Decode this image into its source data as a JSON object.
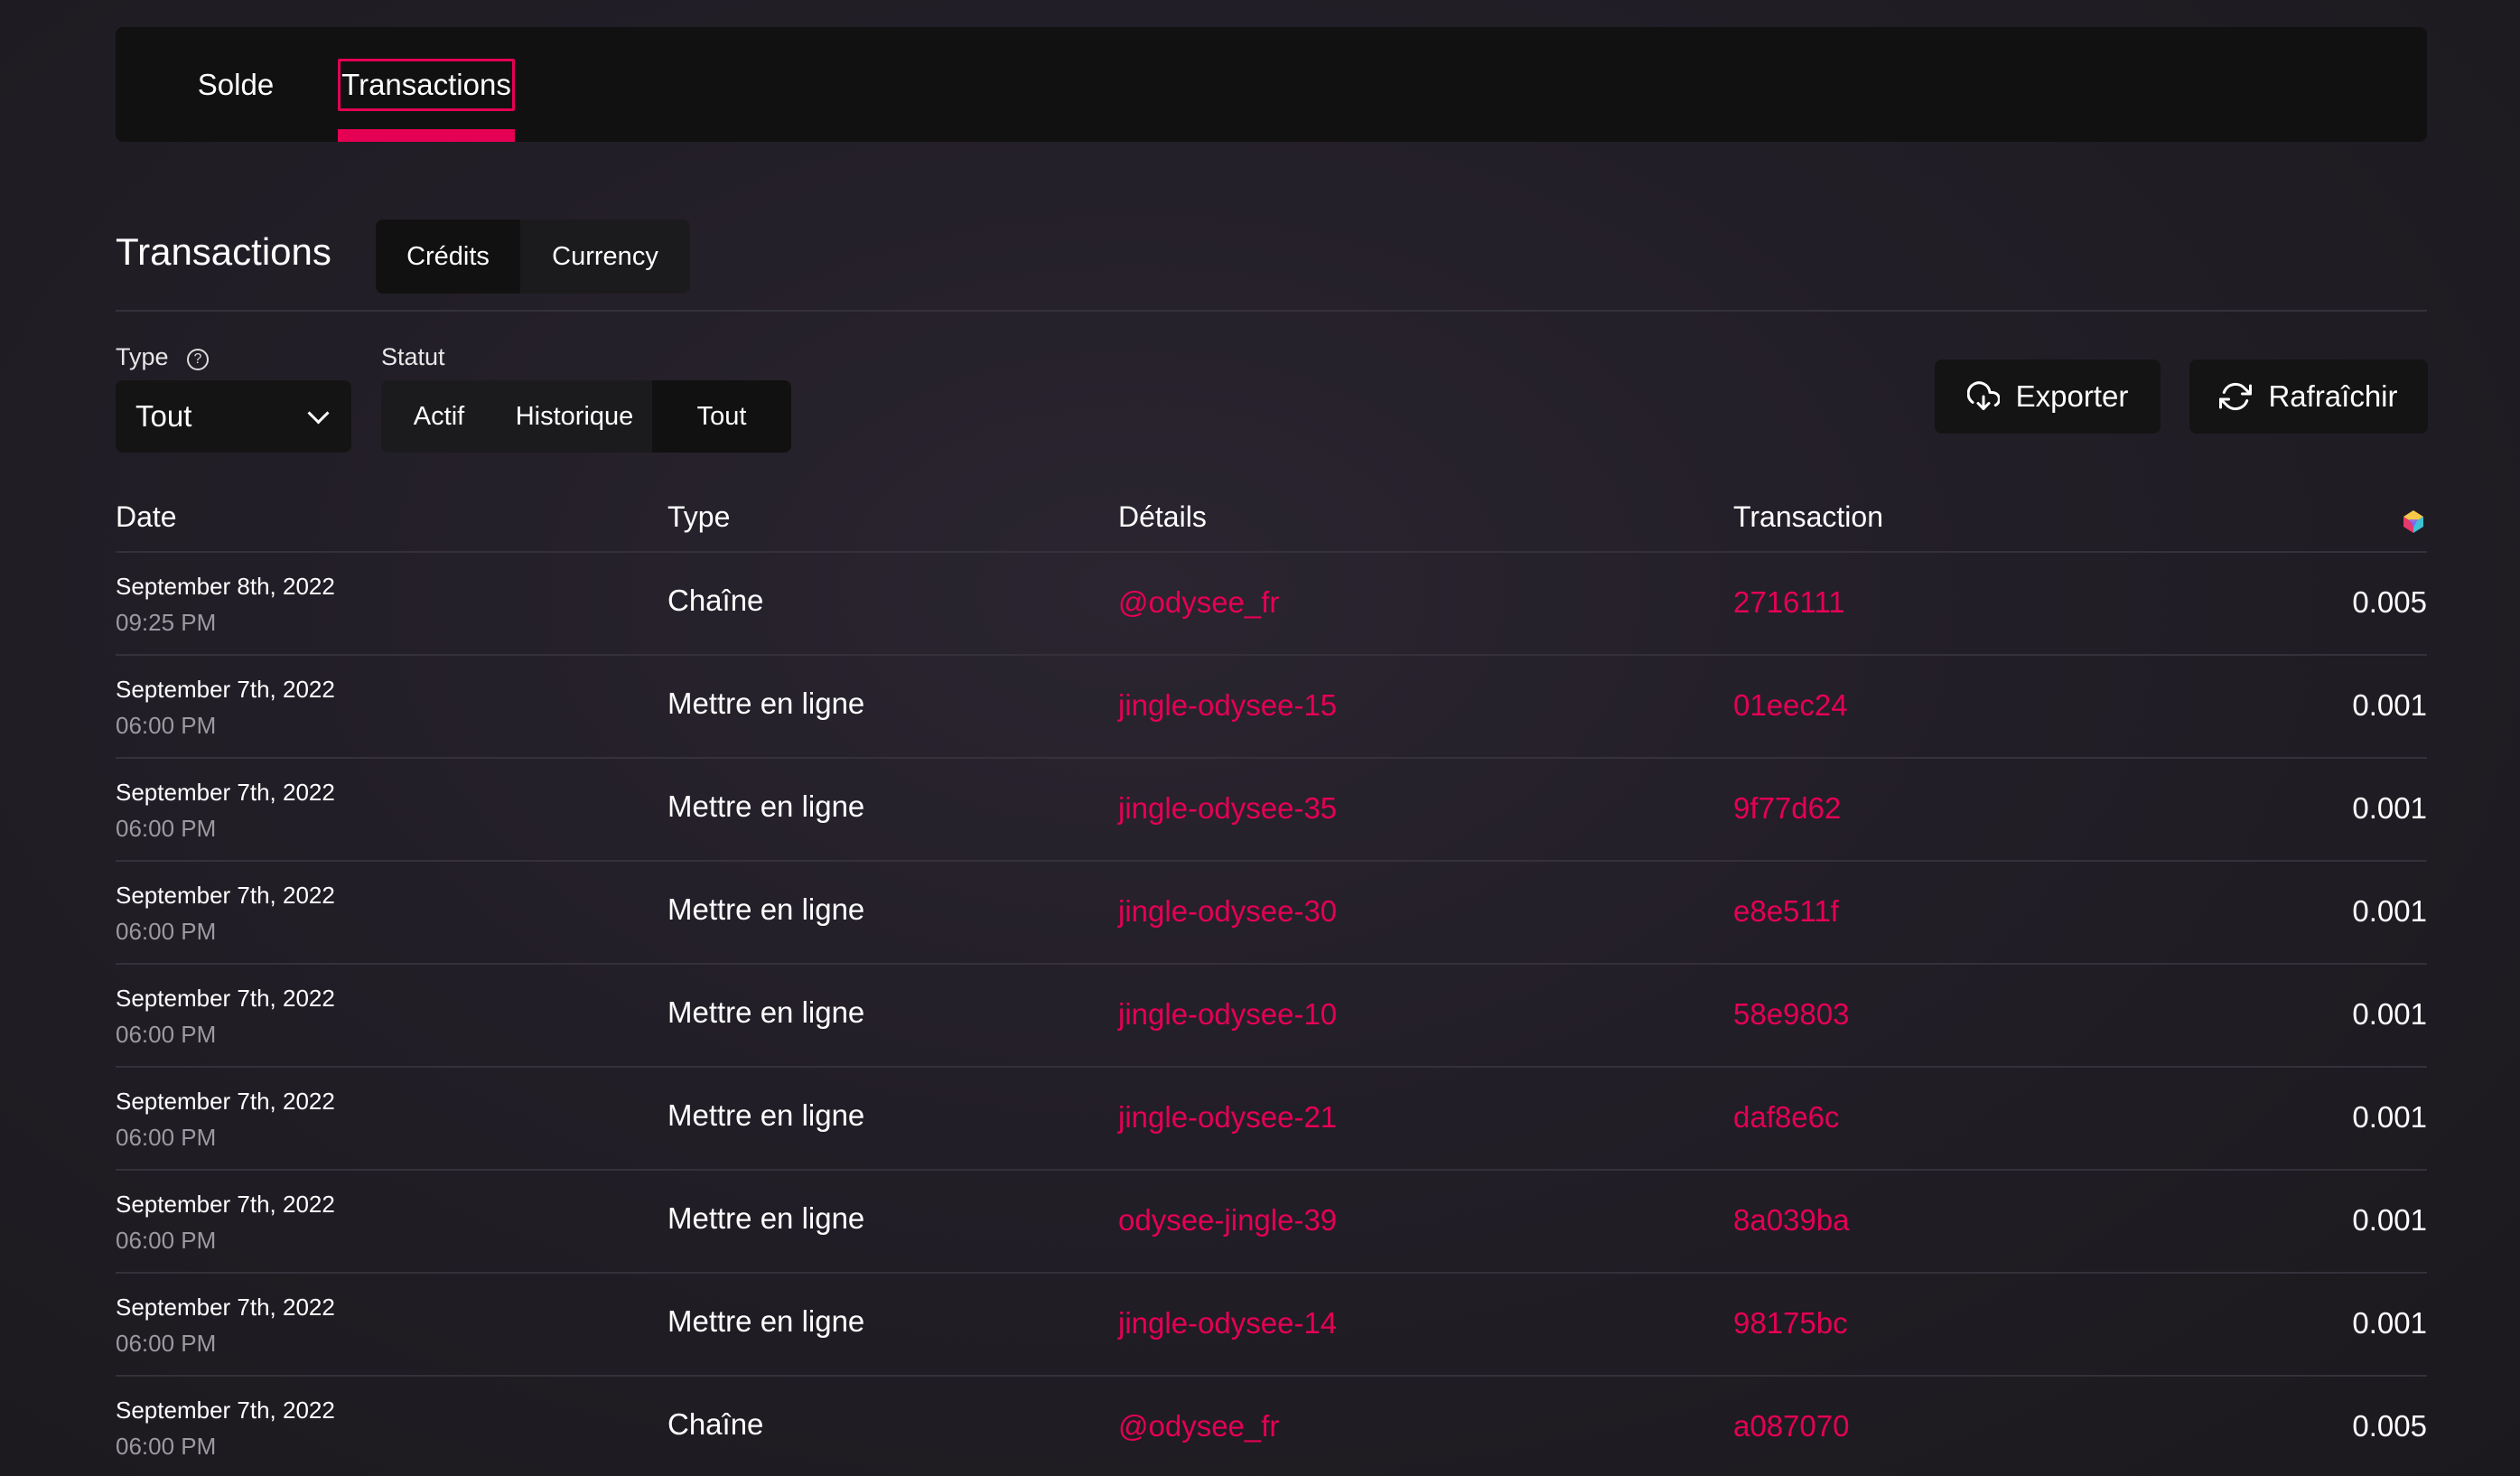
{
  "tabs": {
    "solde": "Solde",
    "transactions": "Transactions"
  },
  "section": {
    "title": "Transactions",
    "currency_options": [
      "Crédits",
      "Currency"
    ]
  },
  "filters": {
    "type_label": "Type",
    "type_value": "Tout",
    "status_label": "Statut",
    "status_options": [
      "Actif",
      "Historique",
      "Tout"
    ],
    "export_label": "Exporter",
    "refresh_label": "Rafraîchir"
  },
  "table": {
    "headers": {
      "date": "Date",
      "type": "Type",
      "details": "Détails",
      "transaction": "Transaction"
    },
    "rows": [
      {
        "date": "September 8th, 2022",
        "time": "09:25 PM",
        "type": "Chaîne",
        "details": "@odysee_fr",
        "transaction": "2716111",
        "amount": "0.005"
      },
      {
        "date": "September 7th, 2022",
        "time": "06:00 PM",
        "type": "Mettre en ligne",
        "details": "jingle-odysee-15",
        "transaction": "01eec24",
        "amount": "0.001"
      },
      {
        "date": "September 7th, 2022",
        "time": "06:00 PM",
        "type": "Mettre en ligne",
        "details": "jingle-odysee-35",
        "transaction": "9f77d62",
        "amount": "0.001"
      },
      {
        "date": "September 7th, 2022",
        "time": "06:00 PM",
        "type": "Mettre en ligne",
        "details": "jingle-odysee-30",
        "transaction": "e8e511f",
        "amount": "0.001"
      },
      {
        "date": "September 7th, 2022",
        "time": "06:00 PM",
        "type": "Mettre en ligne",
        "details": "jingle-odysee-10",
        "transaction": "58e9803",
        "amount": "0.001"
      },
      {
        "date": "September 7th, 2022",
        "time": "06:00 PM",
        "type": "Mettre en ligne",
        "details": "jingle-odysee-21",
        "transaction": "daf8e6c",
        "amount": "0.001"
      },
      {
        "date": "September 7th, 2022",
        "time": "06:00 PM",
        "type": "Mettre en ligne",
        "details": "odysee-jingle-39",
        "transaction": "8a039ba",
        "amount": "0.001"
      },
      {
        "date": "September 7th, 2022",
        "time": "06:00 PM",
        "type": "Mettre en ligne",
        "details": "jingle-odysee-14",
        "transaction": "98175bc",
        "amount": "0.001"
      },
      {
        "date": "September 7th, 2022",
        "time": "06:00 PM",
        "type": "Chaîne",
        "details": "@odysee_fr",
        "transaction": "a087070",
        "amount": "0.005"
      }
    ]
  },
  "colors": {
    "accent": "#e50054",
    "panel": "#111111",
    "background": "#201d25"
  }
}
